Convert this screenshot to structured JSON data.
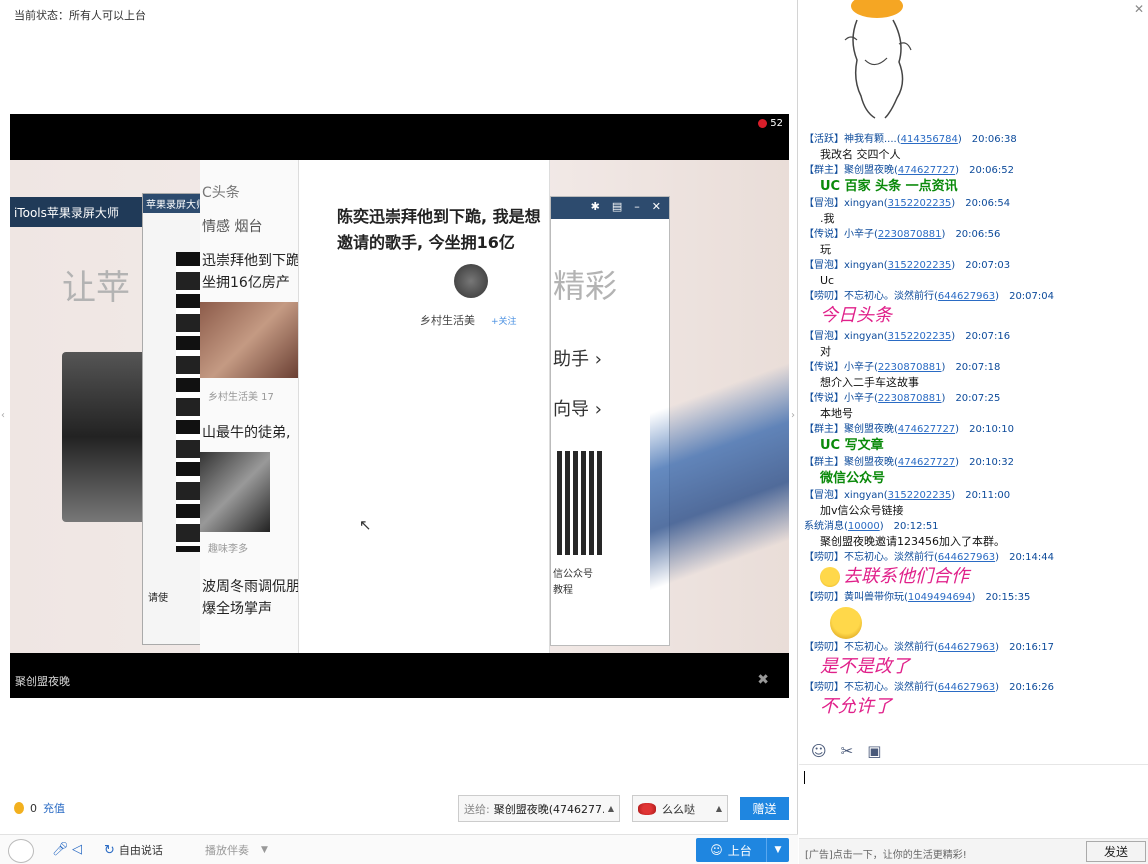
{
  "left": {
    "status": "当前状态：所有人可以上台",
    "rose_count": "52",
    "host_name": "聚创盟夜晚",
    "captured": {
      "itools_title": "iTools苹果录屏大师",
      "promo_text": "让苹",
      "qr_window_title": "苹果录屏大师",
      "qr_window_foot": "请使",
      "news_lines": [
        "C头条",
        "情感    烟台",
        "迅崇拜他到下跪",
        "坐拥16亿房产",
        "乡村生活美   17",
        "山最牛的徒弟,",
        "趣味李多",
        "波周冬雨调侃朋",
        "爆全场掌声"
      ],
      "phone_headline": "陈奕迅崇拜他到下跪, 我是想邀请的歌手, 今坐拥16亿",
      "phone_author": "乡村生活美",
      "phone_follow": "+关注",
      "dialog_big": "精彩",
      "dialog_menu_1": "助手 ›",
      "dialog_menu_2": "向导 ›",
      "dialog_foot_1": "信公众号",
      "dialog_foot_2": "教程"
    }
  },
  "bottom": {
    "coin_count": "0",
    "recharge": "充值",
    "send_to_label": "送给:",
    "send_to_value": "聚创盟夜晚(4746277...",
    "gift_name": "么么哒",
    "gift_button": "赠送",
    "free_talk": "自由说话",
    "play_accompaniment": "播放伴奏",
    "stage_button": "上台"
  },
  "chat": {
    "messages": [
      {
        "tag": "【活跃】",
        "user": "神我有颗....",
        "qq": "414356784",
        "time": "20:06:38",
        "text": "我改名  交四个人",
        "style": "normal"
      },
      {
        "tag": "【群主】",
        "user": "聚创盟夜晚",
        "qq": "474627727",
        "time": "20:06:52",
        "text": "UC 百家 头条 一点资讯",
        "style": "green"
      },
      {
        "tag": "【冒泡】",
        "user": "xingyan",
        "qq": "3152202235",
        "time": "20:06:54",
        "text": ".我",
        "style": "normal"
      },
      {
        "tag": "【传说】",
        "user": "小辛子",
        "qq": "2230870881",
        "time": "20:06:56",
        "text": "玩",
        "style": "normal"
      },
      {
        "tag": "【冒泡】",
        "user": "xingyan",
        "qq": "3152202235",
        "time": "20:07:03",
        "text": "Uc",
        "style": "normal"
      },
      {
        "tag": "【唠叨】",
        "user": "不忘初心。淡然前行",
        "qq": "644627963",
        "time": "20:07:04",
        "text": "今日头条",
        "style": "pink"
      },
      {
        "tag": "【冒泡】",
        "user": "xingyan",
        "qq": "3152202235",
        "time": "20:07:16",
        "text": "对",
        "style": "normal"
      },
      {
        "tag": "【传说】",
        "user": "小辛子",
        "qq": "2230870881",
        "time": "20:07:18",
        "text": "想介入二手车这故事",
        "style": "normal"
      },
      {
        "tag": "【传说】",
        "user": "小辛子",
        "qq": "2230870881",
        "time": "20:07:25",
        "text": "本地号",
        "style": "normal"
      },
      {
        "tag": "【群主】",
        "user": "聚创盟夜晚",
        "qq": "474627727",
        "time": "20:10:10",
        "text": "UC 写文章",
        "style": "green"
      },
      {
        "tag": "【群主】",
        "user": "聚创盟夜晚",
        "qq": "474627727",
        "time": "20:10:32",
        "text": "微信公众号",
        "style": "green"
      },
      {
        "tag": "【冒泡】",
        "user": "xingyan",
        "qq": "3152202235",
        "time": "20:11:00",
        "text": "加v信公众号链接",
        "style": "normal"
      },
      {
        "tag": "",
        "user": "系统消息",
        "qq": "10000",
        "time": "20:12:51",
        "text": "聚创盟夜晚邀请123456加入了本群。",
        "style": "normal"
      },
      {
        "tag": "【唠叨】",
        "user": "不忘初心。淡然前行",
        "qq": "644627963",
        "time": "20:14:44",
        "text": "去联系他们合作",
        "style": "pink-emoji"
      },
      {
        "tag": "【唠叨】",
        "user": "黄叫兽带你玩",
        "qq": "1049494694",
        "time": "20:15:35",
        "text": "",
        "style": "emoji"
      },
      {
        "tag": "【唠叨】",
        "user": "不忘初心。淡然前行",
        "qq": "644627963",
        "time": "20:16:17",
        "text": "是不是改了",
        "style": "pink"
      },
      {
        "tag": "【唠叨】",
        "user": "不忘初心。淡然前行",
        "qq": "644627963",
        "time": "20:16:26",
        "text": "不允许了",
        "style": "pink"
      }
    ],
    "ad_text": "[广告]点击一下，让你的生活更精彩!",
    "send_button": "发送"
  },
  "colors": {
    "accent_blue": "#1f86e0",
    "chat_green": "#0a8a0a",
    "chat_pink": "#e0208a",
    "chat_header": "#0c4a9a"
  }
}
